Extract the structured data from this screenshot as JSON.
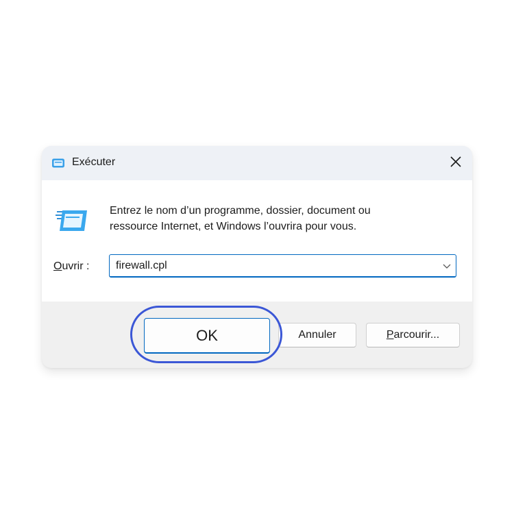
{
  "window": {
    "title": "Exécuter",
    "title_icon": "run-dialog-icon",
    "close_icon": "close-icon"
  },
  "content": {
    "icon": "run-app-icon",
    "description_line1": "Entrez le nom d’un programme, dossier, document ou",
    "description_line2": "ressource Internet, et Windows l’ouvrira pour vous.",
    "open_label_mnemonic": "O",
    "open_label_rest": "uvrir :",
    "open_value": "firewall.cpl",
    "dropdown_icon": "chevron-down-icon"
  },
  "buttons": {
    "ok_label": "OK",
    "cancel_label": "Annuler",
    "browse_mnemonic": "P",
    "browse_rest": "arcourir..."
  },
  "colors": {
    "accent": "#0067c0",
    "highlight_ring": "#3b57d6",
    "footer_bg": "#f0f0f0",
    "titlebar_bg": "#eef1f6"
  }
}
